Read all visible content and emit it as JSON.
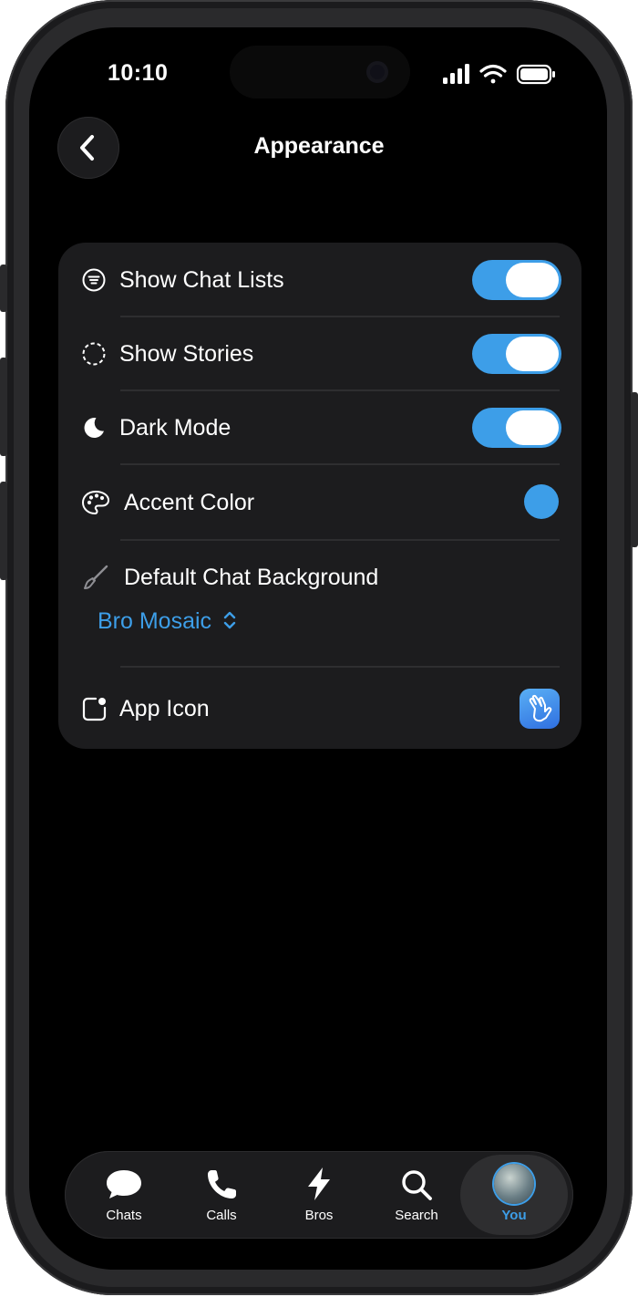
{
  "status_bar": {
    "time": "10:10"
  },
  "header": {
    "title": "Appearance"
  },
  "settings": {
    "show_chat_lists": {
      "label": "Show Chat Lists",
      "enabled": true
    },
    "show_stories": {
      "label": "Show Stories",
      "enabled": true
    },
    "dark_mode": {
      "label": "Dark Mode",
      "enabled": true
    },
    "accent_color": {
      "label": "Accent Color",
      "value_color": "#3d9ee8"
    },
    "default_chat_background": {
      "label": "Default Chat Background",
      "value": "Bro Mosaic"
    },
    "app_icon": {
      "label": "App Icon"
    }
  },
  "tabbar": {
    "tabs": [
      {
        "label": "Chats",
        "icon": "chat-bubble-icon"
      },
      {
        "label": "Calls",
        "icon": "phone-icon"
      },
      {
        "label": "Bros",
        "icon": "lightning-icon"
      },
      {
        "label": "Search",
        "icon": "search-icon"
      },
      {
        "label": "You",
        "icon": "avatar",
        "active": true
      }
    ]
  },
  "colors": {
    "accent": "#3d9ee8",
    "card": "#1c1c1e",
    "background": "#000000"
  }
}
